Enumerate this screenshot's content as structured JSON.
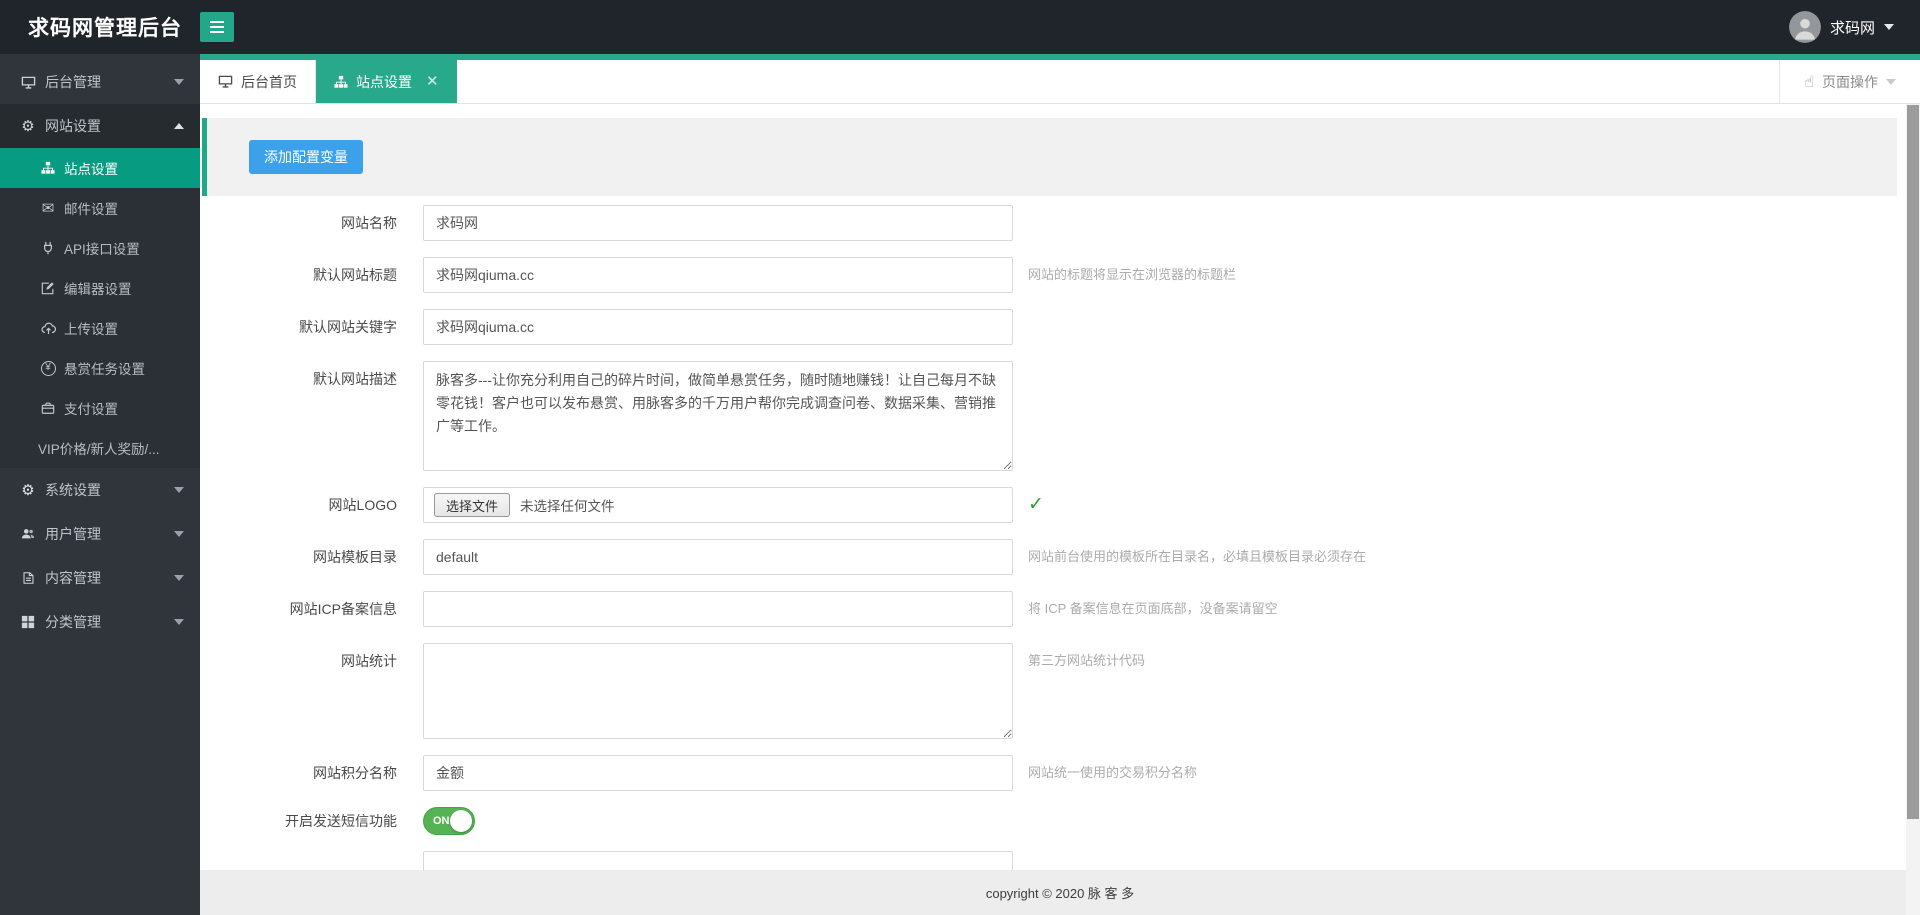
{
  "header": {
    "title": "求码网管理后台",
    "user_name": "求码网"
  },
  "sidebar": {
    "items": [
      {
        "label": "后台管理",
        "icon": "desktop-icon",
        "chevron": "down"
      },
      {
        "label": "网站设置",
        "icon": "gears-icon",
        "chevron": "up",
        "expanded": true,
        "children": [
          {
            "label": "站点设置",
            "icon": "sitemap-icon",
            "active": true
          },
          {
            "label": "邮件设置",
            "icon": "mail-icon"
          },
          {
            "label": "API接口设置",
            "icon": "plug-icon"
          },
          {
            "label": "编辑器设置",
            "icon": "edit-icon"
          },
          {
            "label": "上传设置",
            "icon": "cloud-upload-icon"
          },
          {
            "label": "悬赏任务设置",
            "icon": "yen-icon"
          },
          {
            "label": "支付设置",
            "icon": "wallet-icon"
          },
          {
            "label": "VIP价格/新人奖励/...",
            "icon": null
          }
        ]
      },
      {
        "label": "系统设置",
        "icon": "gear-icon",
        "chevron": "down"
      },
      {
        "label": "用户管理",
        "icon": "users-icon",
        "chevron": "down"
      },
      {
        "label": "内容管理",
        "icon": "document-icon",
        "chevron": "down"
      },
      {
        "label": "分类管理",
        "icon": "grid-icon",
        "chevron": "down"
      }
    ]
  },
  "tabs": [
    {
      "label": "后台首页",
      "icon": "desktop-icon",
      "active": false
    },
    {
      "label": "站点设置",
      "icon": "sitemap-icon",
      "active": true,
      "closable": true
    }
  ],
  "page_actions": {
    "label": "页面操作"
  },
  "toolbar": {
    "add_config_button": "添加配置变量"
  },
  "form": {
    "fields": [
      {
        "label": "网站名称",
        "type": "text",
        "value": "求码网",
        "hint": ""
      },
      {
        "label": "默认网站标题",
        "type": "text",
        "value": "求码网qiuma.cc",
        "hint": "网站的标题将显示在浏览器的标题栏"
      },
      {
        "label": "默认网站关键字",
        "type": "text",
        "value": "求码网qiuma.cc",
        "hint": ""
      },
      {
        "label": "默认网站描述",
        "type": "textarea",
        "value": "脉客多---让你充分利用自己的碎片时间，做简单悬赏任务，随时随地赚钱！让自己每月不缺零花钱！客户也可以发布悬赏、用脉客多的千万用户帮你完成调查问卷、数据采集、营销推广等工作。",
        "hint": ""
      },
      {
        "label": "网站LOGO",
        "type": "file",
        "button": "选择文件",
        "file_text": "未选择任何文件",
        "suffix": "check"
      },
      {
        "label": "网站模板目录",
        "type": "text",
        "value": "default",
        "hint": "网站前台使用的模板所在目录名，必填且模板目录必须存在"
      },
      {
        "label": "网站ICP备案信息",
        "type": "text",
        "value": "",
        "hint": "将 ICP 备案信息在页面底部，没备案请留空"
      },
      {
        "label": "网站统计",
        "type": "textarea",
        "value": "",
        "hint": "第三方网站统计代码"
      },
      {
        "label": "网站积分名称",
        "type": "text",
        "value": "金额",
        "hint": "网站统一使用的交易积分名称"
      },
      {
        "label": "开启发送短信功能",
        "type": "toggle",
        "state": "ON"
      }
    ]
  },
  "footer": {
    "copyright": "copyright © 2020 脉 客 多"
  },
  "colors": {
    "accent_teal": "#29a98c",
    "sidebar_active": "#079b82",
    "button_blue": "#3ba1ea",
    "toggle_green": "#55b255",
    "check_green": "#2e9b2e",
    "header_bg": "#20252b",
    "sidebar_bg": "#2f353b"
  }
}
